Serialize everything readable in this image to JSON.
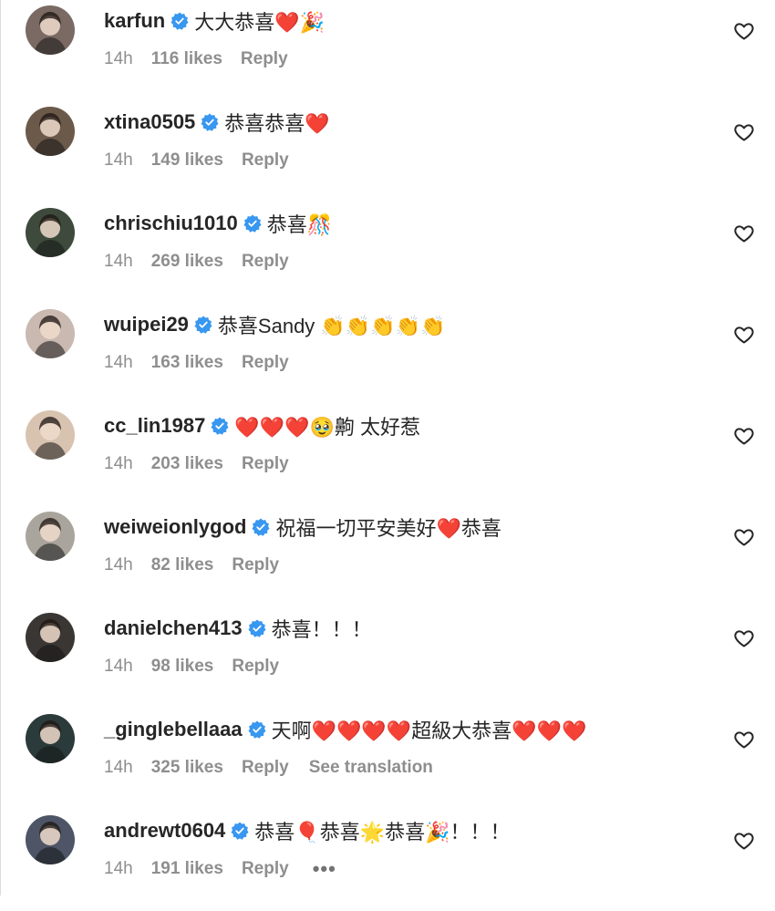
{
  "colors": {
    "verified": "#3897f0",
    "secondary_text": "#8e8e8e",
    "primary_text": "#262626"
  },
  "icons": {
    "verified": "verified-badge-icon",
    "like": "heart-outline-icon",
    "more": "more-options-icon"
  },
  "avatar_colors": [
    "#7a6a63",
    "#6b5a4a",
    "#3d4a3c",
    "#c9b9b0",
    "#d8c2b0",
    "#a9a49c",
    "#3a3633",
    "#2b3a3a",
    "#4d5566"
  ],
  "comments": [
    {
      "username": "karfun",
      "text": "大大恭喜❤️🎉",
      "time": "14h",
      "likes": "116 likes",
      "reply": "Reply"
    },
    {
      "username": "xtina0505",
      "text": "恭喜恭喜❤️",
      "time": "14h",
      "likes": "149 likes",
      "reply": "Reply"
    },
    {
      "username": "chrischiu1010",
      "text": "恭喜🎊",
      "time": "14h",
      "likes": "269 likes",
      "reply": "Reply"
    },
    {
      "username": "wuipei29",
      "text": "恭喜Sandy 👏👏👏👏👏",
      "time": "14h",
      "likes": "163 likes",
      "reply": "Reply"
    },
    {
      "username": "cc_lin1987",
      "text": "❤️❤️❤️🥹齁 太好惹",
      "time": "14h",
      "likes": "203 likes",
      "reply": "Reply"
    },
    {
      "username": "weiweionlygod",
      "text": "祝福一切平安美好❤️恭喜",
      "time": "14h",
      "likes": "82 likes",
      "reply": "Reply"
    },
    {
      "username": "danielchen413",
      "text": "恭喜！！！",
      "time": "14h",
      "likes": "98 likes",
      "reply": "Reply"
    },
    {
      "username": "_ginglebellaaa",
      "text": "天啊❤️❤️❤️❤️超級大恭喜❤️❤️❤️",
      "time": "14h",
      "likes": "325 likes",
      "reply": "Reply",
      "translation": "See translation"
    },
    {
      "username": "andrewt0604",
      "text": "恭喜🎈恭喜🌟恭喜🎉！！！",
      "time": "14h",
      "likes": "191 likes",
      "reply": "Reply",
      "more": "•••"
    }
  ]
}
